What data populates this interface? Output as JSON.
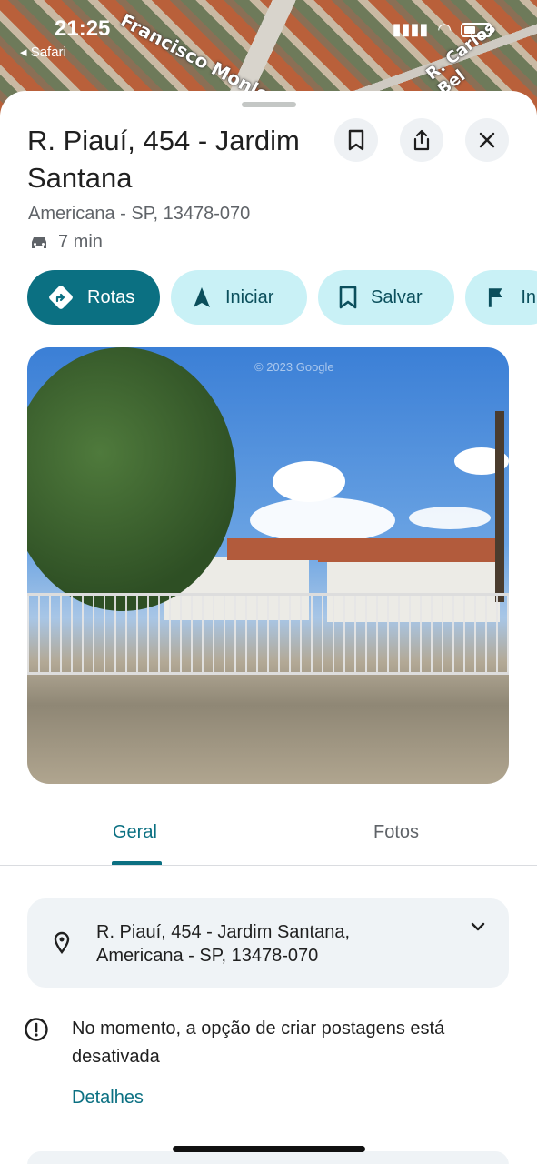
{
  "status": {
    "time": "21:25",
    "back_app": "Safari"
  },
  "map": {
    "road1": "Francisco Monlevade",
    "road2": "R. Carlos Bel"
  },
  "place": {
    "title": "R. Piauí, 454 - Jardim Santana",
    "subtitle": "Americana - SP, 13478-070",
    "drive_time": "7 min"
  },
  "header_icons": [
    "bookmark-icon",
    "share-icon",
    "close-icon"
  ],
  "actions": [
    {
      "label": "Rotas",
      "icon": "directions-icon"
    },
    {
      "label": "Iniciar",
      "icon": "navigation-icon"
    },
    {
      "label": "Salvar",
      "icon": "bookmark-icon"
    },
    {
      "label": "In",
      "icon": "flag-icon"
    }
  ],
  "photo": {
    "watermark": "© 2023 Google"
  },
  "tabs": [
    {
      "label": "Geral",
      "active": true
    },
    {
      "label": "Fotos",
      "active": false
    }
  ],
  "address_card": {
    "line1": "R. Piauí, 454 - Jardim Santana,",
    "line2": "Americana - SP, 13478-070"
  },
  "notice": {
    "text": "No momento, a opção de criar postagens está desativada",
    "link": "Detalhes"
  },
  "colors": {
    "accent": "#0b7082",
    "chip_light": "#c9f1f6",
    "card_bg": "#eff3f6"
  }
}
